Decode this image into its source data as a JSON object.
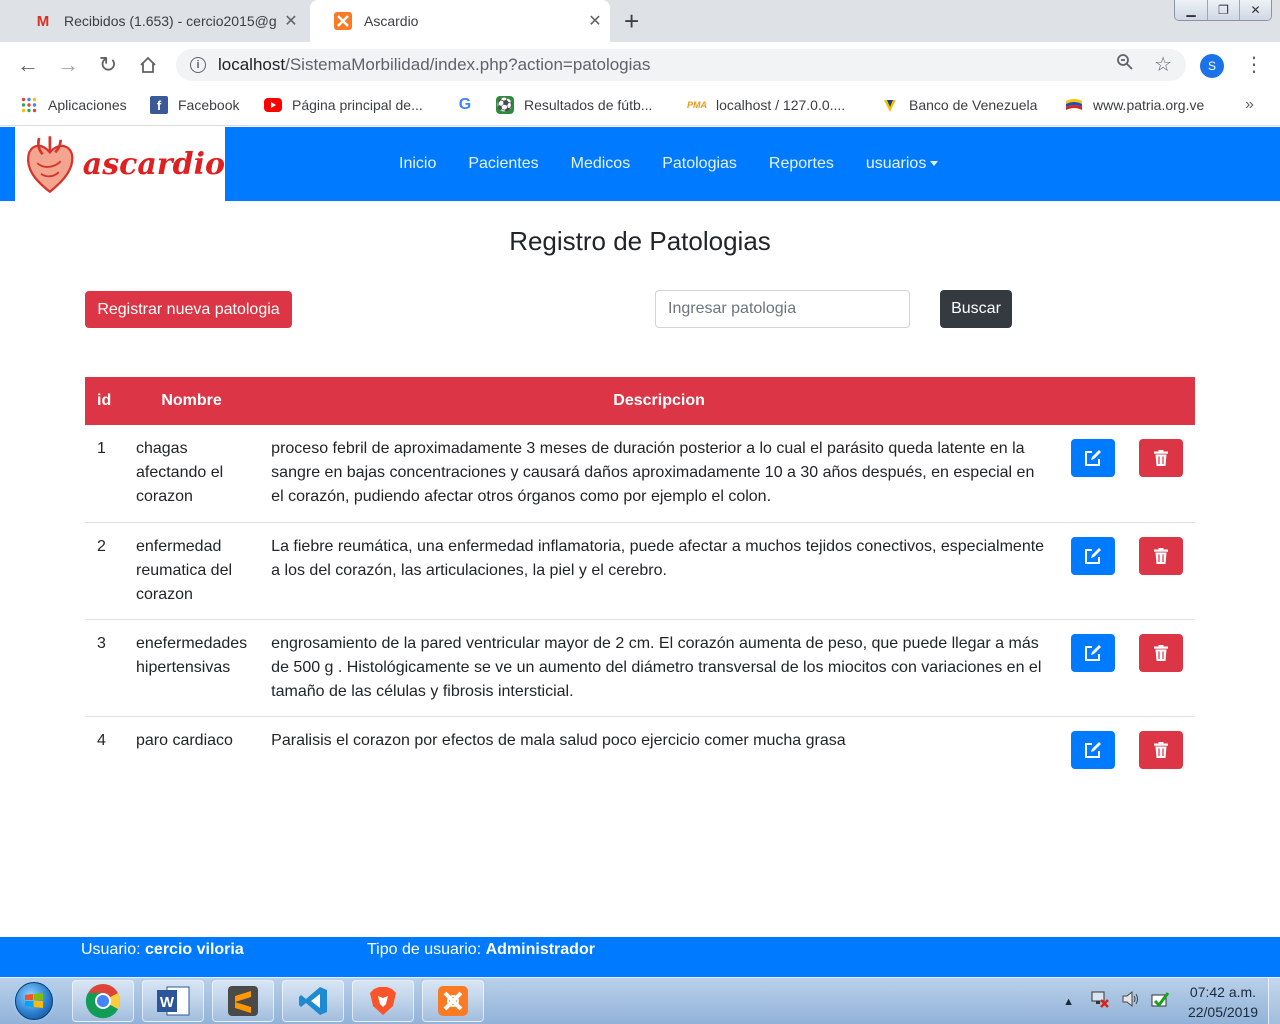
{
  "browser": {
    "tabs": [
      {
        "title": "Recibidos (1.653) - cercio2015@g",
        "favicon": "gmail-icon"
      },
      {
        "title": "Ascardio",
        "favicon": "xampp-icon"
      }
    ],
    "url_host": "localhost",
    "url_path": "/SistemaMorbilidad/index.php?action=patologias",
    "profile_initial": "S",
    "bookmarks": [
      {
        "label": "Aplicaciones",
        "icon": "apps-grid-icon"
      },
      {
        "label": "Facebook",
        "icon": "facebook-icon"
      },
      {
        "label": "Página principal de...",
        "icon": "youtube-icon"
      },
      {
        "label": "",
        "icon": "google-icon"
      },
      {
        "label": "Resultados de fútb...",
        "icon": "soccer-icon"
      },
      {
        "label": "localhost / 127.0.0....",
        "icon": "phpmyadmin-icon"
      },
      {
        "label": "Banco de Venezuela",
        "icon": "bank-icon"
      },
      {
        "label": "www.patria.org.ve",
        "icon": "patria-icon"
      }
    ],
    "bookmarks_more": "»"
  },
  "navbar": {
    "brand": "ascardio",
    "links": [
      "Inicio",
      "Pacientes",
      "Medicos",
      "Patologias",
      "Reportes",
      "usuarios"
    ]
  },
  "page": {
    "title": "Registro de Patologias",
    "register_button": "Registrar nueva patologia",
    "search_placeholder": "Ingresar patologia",
    "search_button": "Buscar"
  },
  "table": {
    "headers": [
      "id",
      "Nombre",
      "Descripcion"
    ],
    "rows": [
      {
        "id": "1",
        "name": "chagas afectando el corazon",
        "description": "proceso febril de aproximadamente 3 meses de duración posterior a lo cual el parásito queda latente en la sangre en bajas concentraciones y causará daños aproximadamente 10 a 30 años después, en especial en el corazón, pudiendo afectar otros órganos como por ejemplo el colon."
      },
      {
        "id": "2",
        "name": "enfermedad reumatica del corazon",
        "description": "La fiebre reumática, una enfermedad inflamatoria, puede afectar a muchos tejidos conectivos, especialmente a los del corazón, las articulaciones, la piel y el cerebro."
      },
      {
        "id": "3",
        "name": "enefermedades hipertensivas",
        "description": "engrosamiento de la pared ventricular mayor de 2 cm. El corazón aumenta de peso, que puede llegar a más de 500 g . Histológicamente se ve un aumento del diámetro transversal de los miocitos con variaciones en el tamaño de las células y fibrosis intersticial."
      },
      {
        "id": "4",
        "name": "paro cardiaco",
        "description": "Paralisis el corazon por efectos de mala salud poco ejercicio comer mucha grasa"
      }
    ]
  },
  "footer": {
    "user_label": "Usuario:",
    "user_value": "cercio viloria",
    "type_label": "Tipo de usuario:",
    "type_value": "Administrador"
  },
  "taskbar": {
    "apps": [
      "chrome-icon",
      "word-icon",
      "sublime-text-icon",
      "vscode-icon",
      "brave-icon",
      "xampp-icon"
    ],
    "time": "07:42 a.m.",
    "date": "22/05/2019"
  },
  "colors": {
    "primary": "#007bff",
    "danger": "#dc3545",
    "dark": "#343a40"
  }
}
